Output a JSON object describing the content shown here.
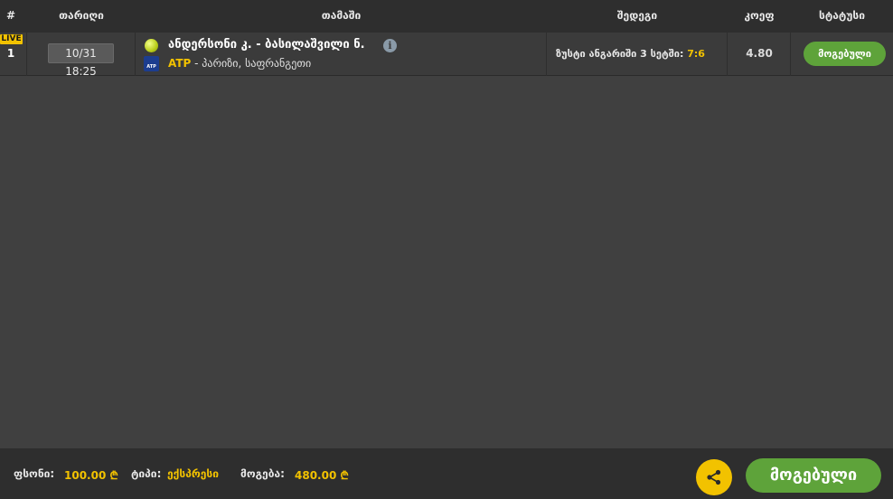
{
  "header": {
    "num": "#",
    "date": "თარიღი",
    "match": "თამაში",
    "bet": "შედეგი",
    "odds": "კოეფ",
    "status": "სტატუსი"
  },
  "bet_row": {
    "live_badge": "LIVE",
    "number": "1",
    "date": "10/31 18:25",
    "match_title": "ანდერსონი კ. - ბასილაშვილი ნ.",
    "info_glyph": "i",
    "sport_icon": "tennis-ball-icon",
    "league_icon": "atp-logo-icon",
    "league_icon_text": "ATP",
    "league": "ATP",
    "location": " - პარიზი, საფრანგეთი",
    "bet_label": "ზუსტი ანგარიში 3 სეტში: ",
    "bet_value": "7:6",
    "odds": "4.80",
    "status": "მოგებული"
  },
  "footer": {
    "stake_label": "ფსონი:",
    "stake_value": "100.00 ₾",
    "type_label": "ტიპი:",
    "type_value": "ექსპრესი",
    "win_label": "მოგება:",
    "win_value": "480.00 ₾",
    "share_icon": "share-icon",
    "result_button": "მოგებული"
  },
  "colors": {
    "background": "#404040",
    "header": "#2e2e2e",
    "accent": "#f2c200",
    "won": "#5ea33a"
  }
}
